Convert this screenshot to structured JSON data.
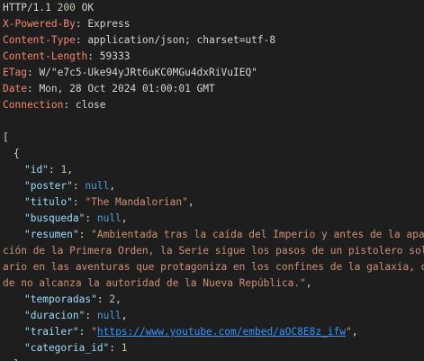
{
  "response": {
    "status_line": {
      "proto": "HTTP/1.1",
      "code": "200",
      "text": "OK"
    },
    "headers": [
      {
        "key": "X-Powered-By",
        "value": "Express"
      },
      {
        "key": "Content-Type",
        "value": "application/json; charset=utf-8"
      },
      {
        "key": "Content-Length",
        "value": "59333"
      },
      {
        "key": "ETag",
        "value": "W/\"e7c5-Uke94yJRt6uKC0MGu4dxRiVuIEQ\""
      },
      {
        "key": "Date",
        "value": "Mon, 28 Oct 2024 01:00:01 GMT"
      },
      {
        "key": "Connection",
        "value": "close"
      }
    ]
  },
  "body": {
    "open_bracket": "[",
    "open_brace": "{",
    "close_brace": "},",
    "item": {
      "id": {
        "key": "\"id\"",
        "value": "1"
      },
      "poster": {
        "key": "\"poster\"",
        "value": "null"
      },
      "titulo": {
        "key": "\"titulo\"",
        "value": "\"The Mandalorian\""
      },
      "busqueda": {
        "key": "\"busqueda\"",
        "value": "null"
      },
      "resumen": {
        "key": "\"resumen\"",
        "value_line1": "\"Ambientada tras la caída del Imperio y antes de la apari",
        "value_line2": "ción de la Primera Orden, la Serie sigue los pasos de un pistolero solit",
        "value_line3": "ario en las aventuras que protagoniza en los confines de la galaxia, don",
        "value_line4": "de no alcanza la autoridad de la Nueva República.\""
      },
      "temporadas": {
        "key": "\"temporadas\"",
        "value": "2"
      },
      "duracion": {
        "key": "\"duracion\"",
        "value": "null"
      },
      "trailer": {
        "key": "\"trailer\"",
        "value_url": "https://www.youtube.com/embed/aOC8E8z_ifw"
      },
      "categoria_id": {
        "key": "\"categoria_id\"",
        "value": "1"
      }
    }
  }
}
